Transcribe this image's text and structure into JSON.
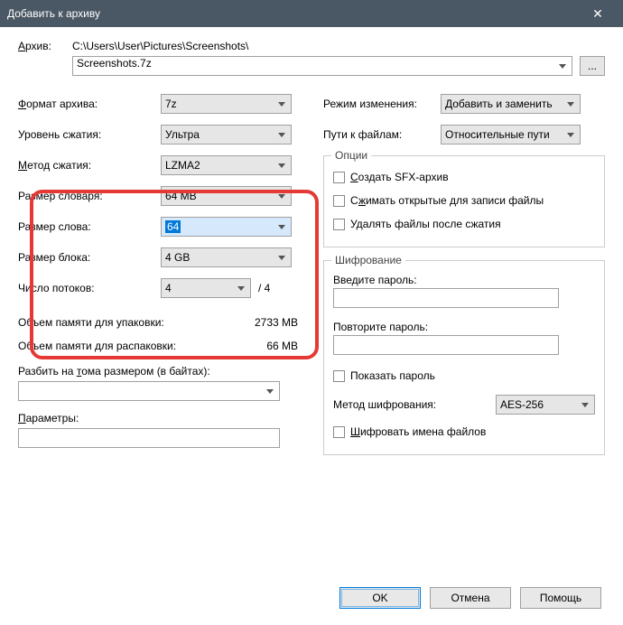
{
  "window": {
    "title": "Добавить к архиву"
  },
  "archive": {
    "label": "Архив:",
    "path": "C:\\Users\\User\\Pictures\\Screenshots\\",
    "filename": "Screenshots.7z",
    "browse": "..."
  },
  "left": {
    "format_label": "Формат архива:",
    "format_value": "7z",
    "level_label": "Уровень сжатия:",
    "level_value": "Ультра",
    "method_label": "Метод сжатия:",
    "method_value": "LZMA2",
    "dict_label": "Размер словаря:",
    "dict_value": "64 MB",
    "word_label": "Размер слова:",
    "word_value": "64",
    "block_label": "Размер блока:",
    "block_value": "4 GB",
    "threads_label": "Число потоков:",
    "threads_value": "4",
    "threads_max": "/ 4",
    "mem_pack_label": "Объем памяти для упаковки:",
    "mem_pack_value": "2733 MB",
    "mem_unpack_label": "Объем памяти для распаковки:",
    "mem_unpack_value": "66 MB",
    "split_label": "Разбить на тома размером (в байтах):",
    "params_label": "Параметры:"
  },
  "right": {
    "mode_label": "Режим изменения:",
    "mode_value": "Добавить и заменить",
    "paths_label": "Пути к файлам:",
    "paths_value": "Относительные пути",
    "options_legend": "Опции",
    "opt_sfx": "Создать SFX-архив",
    "opt_shared": "Сжимать открытые для записи файлы",
    "opt_delete": "Удалять файлы после сжатия",
    "enc_legend": "Шифрование",
    "pw_label": "Введите пароль:",
    "pw2_label": "Повторите пароль:",
    "show_pw": "Показать пароль",
    "enc_method_label": "Метод шифрования:",
    "enc_method_value": "AES-256",
    "enc_names": "Шифровать имена файлов"
  },
  "buttons": {
    "ok": "OK",
    "cancel": "Отмена",
    "help": "Помощь"
  }
}
